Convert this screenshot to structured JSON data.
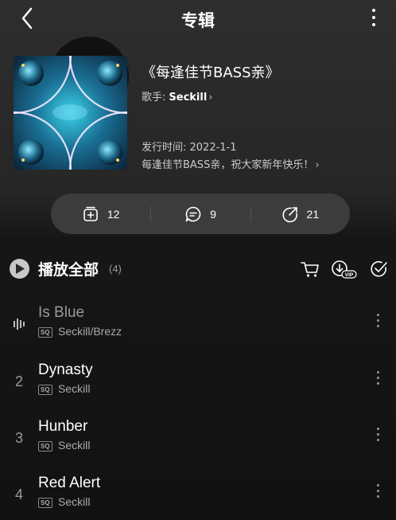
{
  "header": {
    "title": "专辑"
  },
  "album": {
    "name": "《每逢佳节BASS亲》",
    "artist_prefix": "歌手:",
    "artist": "Seckill",
    "release": "发行时间: 2022-1-1",
    "description": "每逢佳节BASS亲，祝大家新年快乐！"
  },
  "actions": {
    "collect_count": "12",
    "comment_count": "9",
    "share_count": "21"
  },
  "playall": {
    "label": "播放全部",
    "count": "(4)"
  },
  "songs": [
    {
      "index": "",
      "name": "Is Blue",
      "quality": "SQ",
      "artist": "Seckill/Brezz",
      "playing": true
    },
    {
      "index": "2",
      "name": "Dynasty",
      "quality": "SQ",
      "artist": "Seckill"
    },
    {
      "index": "3",
      "name": "Hunber",
      "quality": "SQ",
      "artist": "Seckill"
    },
    {
      "index": "4",
      "name": "Red Alert",
      "quality": "SQ",
      "artist": "Seckill"
    }
  ],
  "icons": {
    "back": "chevron-left-icon",
    "more": "more-vertical-icon",
    "collect": "add-to-playlist-icon",
    "comment": "comment-icon",
    "share": "share-icon",
    "play": "play-icon",
    "cart": "cart-icon",
    "download": "download-vip-icon",
    "multi_select": "multi-select-check-icon",
    "playing": "equalizer-icon"
  }
}
